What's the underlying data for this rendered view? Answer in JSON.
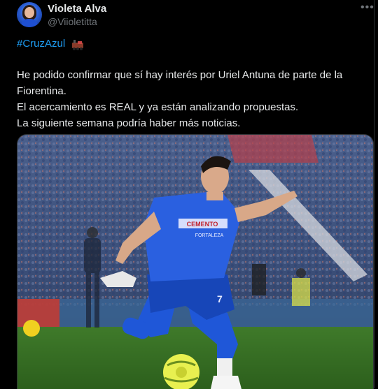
{
  "author": {
    "name": "Violeta Alva",
    "handle": "@Viioletitta"
  },
  "menu_icon": "more-dots-icon",
  "hashtag": "#CruzAzul",
  "hashtag_emoji": "train-emoji",
  "body_lines": [
    "He podido confirmar que sí hay interés por Uriel Antuna de parte de la",
    "Fiorentina.",
    "El acercamiento es REAL y ya están analizando propuestas.",
    "La siguiente semana podría haber más noticias."
  ],
  "photo": {
    "jersey_text": "CEMENTO",
    "jersey_subtext": "FORTALEZA",
    "jersey_number": "7"
  },
  "colors": {
    "background": "#000000",
    "text": "#e7e9ea",
    "secondary_text": "#71767b",
    "link": "#1d9bf0",
    "jersey": "#1f57d8"
  }
}
